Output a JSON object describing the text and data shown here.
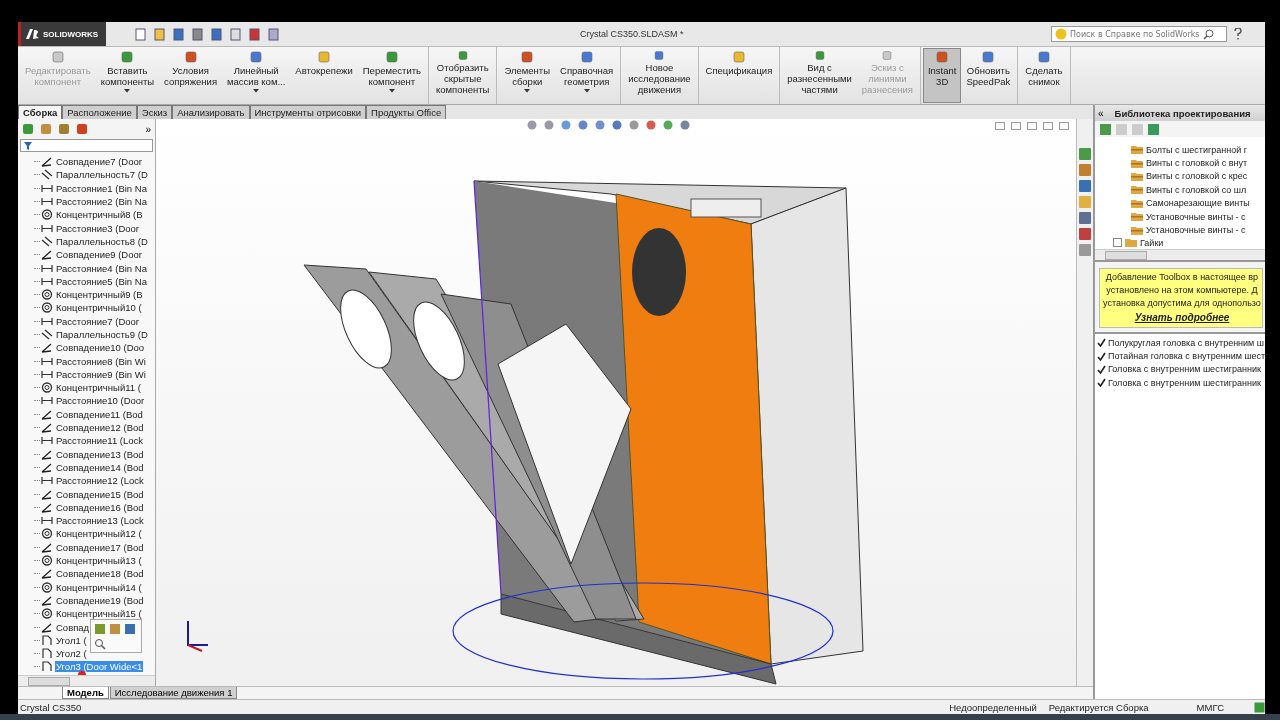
{
  "app": {
    "logo": "SOLIDWORKS"
  },
  "window": {
    "title": "Crystal CS350.SLDASM *"
  },
  "search": {
    "placeholder": "Поиск в Справке по SolidWorks"
  },
  "ribbon": {
    "groups": [
      [
        {
          "lines": [
            "Редактировать",
            "компонент"
          ],
          "disabled": true,
          "dropdown": false,
          "selected": false
        },
        {
          "lines": [
            "Вставить",
            "компоненты"
          ],
          "disabled": false,
          "dropdown": true,
          "selected": false
        },
        {
          "lines": [
            "Условия",
            "сопряжения"
          ],
          "disabled": false,
          "dropdown": false,
          "selected": false
        },
        {
          "lines": [
            "Линейный",
            "массив ком..."
          ],
          "disabled": false,
          "dropdown": true,
          "selected": false
        },
        {
          "lines": [
            "Автокрепежи"
          ],
          "disabled": false,
          "dropdown": false,
          "selected": false
        },
        {
          "lines": [
            "Переместить",
            "компонент"
          ],
          "disabled": false,
          "dropdown": true,
          "selected": false
        }
      ],
      [
        {
          "lines": [
            "Отобразить",
            "скрытые",
            "компоненты"
          ],
          "disabled": false,
          "dropdown": false,
          "selected": false
        }
      ],
      [
        {
          "lines": [
            "Элементы",
            "сборки"
          ],
          "disabled": false,
          "dropdown": true,
          "selected": false
        },
        {
          "lines": [
            "Справочная",
            "геометрия"
          ],
          "disabled": false,
          "dropdown": true,
          "selected": false
        }
      ],
      [
        {
          "lines": [
            "Новое",
            "исследование",
            "движения"
          ],
          "disabled": false,
          "dropdown": false,
          "selected": false
        }
      ],
      [
        {
          "lines": [
            "Спецификация"
          ],
          "disabled": false,
          "dropdown": false,
          "selected": false
        }
      ],
      [
        {
          "lines": [
            "Вид с",
            "разнесенными",
            "частями"
          ],
          "disabled": false,
          "dropdown": false,
          "selected": false
        },
        {
          "lines": [
            "Эскиз с",
            "линиями",
            "разнесения"
          ],
          "disabled": true,
          "dropdown": false,
          "selected": false
        }
      ],
      [
        {
          "lines": [
            "Instant",
            "3D"
          ],
          "disabled": false,
          "dropdown": false,
          "selected": true
        },
        {
          "lines": [
            "Обновить",
            "SpeedPak"
          ],
          "disabled": false,
          "dropdown": false,
          "selected": false
        }
      ],
      [
        {
          "lines": [
            "Сделать",
            "снимок"
          ],
          "disabled": false,
          "dropdown": false,
          "selected": false
        }
      ]
    ]
  },
  "tabs": [
    {
      "label": "Сборка",
      "selected": true
    },
    {
      "label": "Расположение",
      "selected": false
    },
    {
      "label": "Эскиз",
      "selected": false
    },
    {
      "label": "Анализировать",
      "selected": false
    },
    {
      "label": "Инструменты отрисовки",
      "selected": false
    },
    {
      "label": "Продукты Office",
      "selected": false
    }
  ],
  "tree": {
    "expand_label": "»",
    "items": [
      {
        "kind": "coincident",
        "label": "Совпадение7 (Door",
        "selected": false
      },
      {
        "kind": "parallel",
        "label": "Параллельность7 (D",
        "selected": false
      },
      {
        "kind": "distance",
        "label": "Расстояние1 (Bin Na",
        "selected": false
      },
      {
        "kind": "distance",
        "label": "Расстояние2 (Bin Na",
        "selected": false
      },
      {
        "kind": "concentric",
        "label": "Концентричный8 (B",
        "selected": false
      },
      {
        "kind": "distance",
        "label": "Расстояние3 (Door",
        "selected": false
      },
      {
        "kind": "parallel",
        "label": "Параллельность8 (D",
        "selected": false
      },
      {
        "kind": "coincident",
        "label": "Совпадение9 (Door",
        "selected": false
      },
      {
        "kind": "distance",
        "label": "Расстояние4 (Bin Na",
        "selected": false
      },
      {
        "kind": "distance",
        "label": "Расстояние5 (Bin Na",
        "selected": false
      },
      {
        "kind": "concentric",
        "label": "Концентричный9 (B",
        "selected": false
      },
      {
        "kind": "concentric",
        "label": "Концентричный10 (",
        "selected": false
      },
      {
        "kind": "distance",
        "label": "Расстояние7 (Door",
        "selected": false
      },
      {
        "kind": "parallel",
        "label": "Параллельность9 (D",
        "selected": false
      },
      {
        "kind": "coincident",
        "label": "Совпадение10 (Doo",
        "selected": false
      },
      {
        "kind": "distance",
        "label": "Расстояние8 (Bin Wi",
        "selected": false
      },
      {
        "kind": "distance",
        "label": "Расстояние9 (Bin Wi",
        "selected": false
      },
      {
        "kind": "concentric",
        "label": "Концентричный11 (",
        "selected": false
      },
      {
        "kind": "distance",
        "label": "Расстояние10 (Door",
        "selected": false
      },
      {
        "kind": "coincident",
        "label": "Совпадение11 (Bod",
        "selected": false
      },
      {
        "kind": "coincident",
        "label": "Совпадение12 (Bod",
        "selected": false
      },
      {
        "kind": "distance",
        "label": "Расстояние11 (Lock",
        "selected": false
      },
      {
        "kind": "coincident",
        "label": "Совпадение13 (Bod",
        "selected": false
      },
      {
        "kind": "coincident",
        "label": "Совпадение14 (Bod",
        "selected": false
      },
      {
        "kind": "distance",
        "label": "Расстояние12 (Lock",
        "selected": false
      },
      {
        "kind": "coincident",
        "label": "Совпадение15 (Bod",
        "selected": false
      },
      {
        "kind": "coincident",
        "label": "Совпадение16 (Bod",
        "selected": false
      },
      {
        "kind": "distance",
        "label": "Расстояние13 (Lock",
        "selected": false
      },
      {
        "kind": "concentric",
        "label": "Концентричный12 (",
        "selected": false
      },
      {
        "kind": "coincident",
        "label": "Совпадение17 (Bod",
        "selected": false
      },
      {
        "kind": "concentric",
        "label": "Концентричный13 (",
        "selected": false
      },
      {
        "kind": "coincident",
        "label": "Совпадение18 (Bod",
        "selected": false
      },
      {
        "kind": "concentric",
        "label": "Концентричный14 (",
        "selected": false
      },
      {
        "kind": "coincident",
        "label": "Совпадение19 (Bod",
        "selected": false
      },
      {
        "kind": "concentric",
        "label": "Концентричный15 (",
        "selected": false
      },
      {
        "kind": "coincident",
        "label": "Совпад",
        "selected": false
      },
      {
        "kind": "angle",
        "label": "Угол1 (",
        "selected": false
      },
      {
        "kind": "angle",
        "label": "Угол2 (",
        "selected": false
      },
      {
        "kind": "angle",
        "label": "Угол3 (Door Wide<1",
        "selected": true
      }
    ]
  },
  "bottom_tabs": [
    {
      "label": "Модель",
      "selected": true
    },
    {
      "label": "Исследование движения 1",
      "selected": false
    }
  ],
  "library": {
    "title": "Библиотека проектирования",
    "collapse_label": "«",
    "folders": [
      "Болты с шестигранной г",
      "Винты с головкой с внут",
      "Винты с головкой с крес",
      "Винты с головкой со шл",
      "Самонарезающие винты",
      "Установочные винты - с",
      "Установочные винты - с"
    ],
    "parent_folder": "Гайки",
    "notice": {
      "lines": [
        "Добавление Toolbox в настоящее вр",
        "установлено на этом компьютере. Д",
        "установка допустима для однопользо"
      ],
      "link": "Узнать подробнее"
    },
    "items": [
      {
        "label": "Полукруглая головка с внутренним ш",
        "checked": true
      },
      {
        "label": "Потайная головка с внутренним шест",
        "checked": true
      },
      {
        "label": "Головка с внутренним шестигранник",
        "checked": true
      },
      {
        "label": "Головка с внутренним шестигранник",
        "checked": true
      }
    ]
  },
  "status_bar": {
    "document": "Crystal CS350",
    "state": "Недоопределенный",
    "mode": "Редактируется Сборка",
    "units": "ММГС"
  }
}
